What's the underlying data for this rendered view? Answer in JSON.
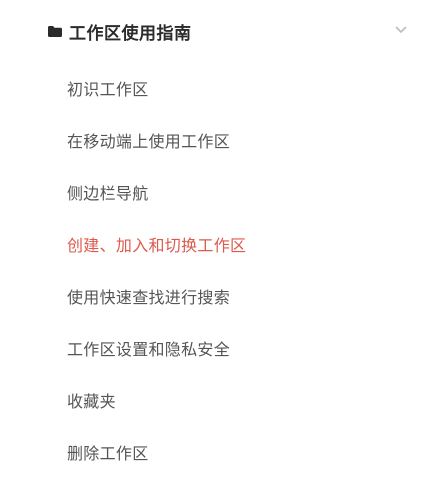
{
  "section": {
    "title": "工作区使用指南",
    "icon": "folder-icon",
    "chevron": "chevron-down-icon",
    "expanded": true
  },
  "items": [
    {
      "label": "初识工作区",
      "active": false
    },
    {
      "label": "在移动端上使用工作区",
      "active": false
    },
    {
      "label": "侧边栏导航",
      "active": false
    },
    {
      "label": "创建、加入和切换工作区",
      "active": true
    },
    {
      "label": "使用快速查找进行搜索",
      "active": false
    },
    {
      "label": "工作区设置和隐私安全",
      "active": false
    },
    {
      "label": "收藏夹",
      "active": false
    },
    {
      "label": "删除工作区",
      "active": false
    }
  ],
  "colors": {
    "active": "#dd5a4c",
    "text": "#555555",
    "title": "#2b2b2b"
  }
}
